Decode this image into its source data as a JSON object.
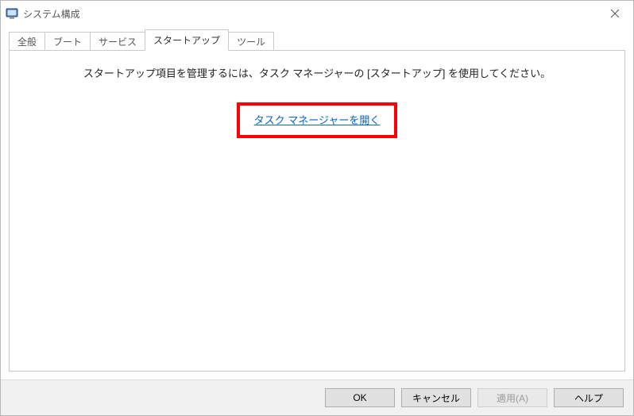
{
  "window": {
    "title": "システム構成"
  },
  "tabs": {
    "items": [
      {
        "label": "全般"
      },
      {
        "label": "ブート"
      },
      {
        "label": "サービス"
      },
      {
        "label": "スタートアップ"
      },
      {
        "label": "ツール"
      }
    ],
    "active_index": 3
  },
  "panel": {
    "message": "スタートアップ項目を管理するには、タスク マネージャーの [スタートアップ] を使用してください。",
    "link_label": "タスク マネージャーを開く"
  },
  "buttons": {
    "ok": "OK",
    "cancel": "キャンセル",
    "apply": "適用(A)",
    "help": "ヘルプ"
  },
  "highlight": {
    "color": "#ff0000"
  }
}
